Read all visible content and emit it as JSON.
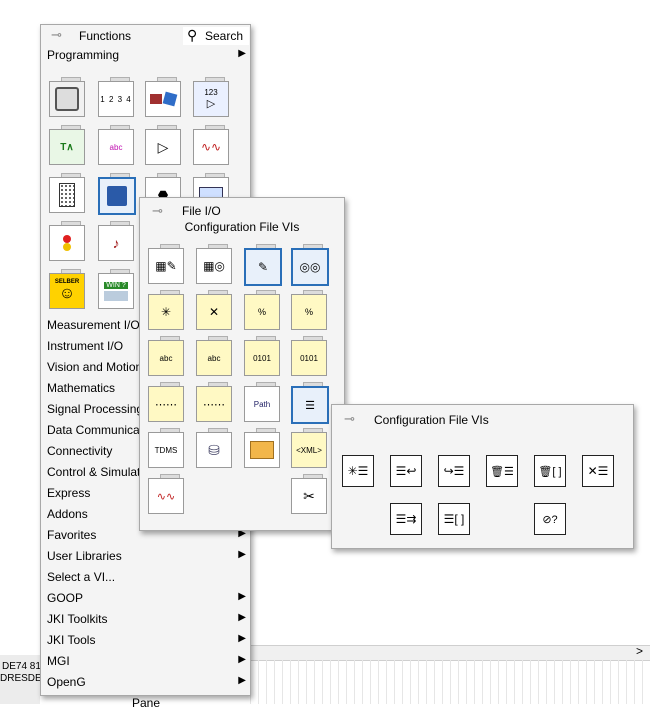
{
  "background": {
    "left_text1": "DE74 81",
    "left_text2": "DRESDEF",
    "bottom_text": "Pane",
    "right_chevron": ">"
  },
  "functions_palette": {
    "title": "Functions",
    "search_label": "Search",
    "programming_label": "Programming",
    "categories": [
      {
        "label": "Measurement I/O",
        "arrow": "▶"
      },
      {
        "label": "Instrument I/O",
        "arrow": "▶"
      },
      {
        "label": "Vision and Motion",
        "arrow": "▶"
      },
      {
        "label": "Mathematics",
        "arrow": "▶"
      },
      {
        "label": "Signal Processing",
        "arrow": "▶"
      },
      {
        "label": "Data Communication",
        "arrow": "▶"
      },
      {
        "label": "Connectivity",
        "arrow": "▶"
      },
      {
        "label": "Control & Simulation",
        "arrow": "▶"
      },
      {
        "label": "Express",
        "arrow": "▶"
      },
      {
        "label": "Addons",
        "arrow": "▶"
      },
      {
        "label": "Favorites",
        "arrow": "▶"
      },
      {
        "label": "User Libraries",
        "arrow": "▶"
      },
      {
        "label": "Select a VI...",
        "arrow": ""
      },
      {
        "label": "GOOP",
        "arrow": "▶"
      },
      {
        "label": "JKI Toolkits",
        "arrow": "▶"
      },
      {
        "label": "JKI Tools",
        "arrow": "▶"
      },
      {
        "label": "MGI",
        "arrow": "▶"
      },
      {
        "label": "OpenG",
        "arrow": "▶"
      }
    ],
    "icon_texts": {
      "array_numbers": "1 2 3 4",
      "numeric_123": "123",
      "string_abc": "abc",
      "selber": "SELBER",
      "win": "WIN ?"
    }
  },
  "fileio_palette": {
    "title": "File I/O",
    "subtitle": "Configuration File VIs",
    "icon_texts": {
      "path": "Path",
      "tdms": "TDMS",
      "xml": "<XML>",
      "abc1": "abc",
      "abc2": "abc",
      "bin1": "0101",
      "bin2": "0101"
    }
  },
  "config_palette": {
    "title": "Configuration File VIs"
  },
  "colors": {
    "selection_border": "#2a6fb8",
    "palette_bg": "#f4f4f4",
    "icon_yellow": "#fff9c4"
  }
}
